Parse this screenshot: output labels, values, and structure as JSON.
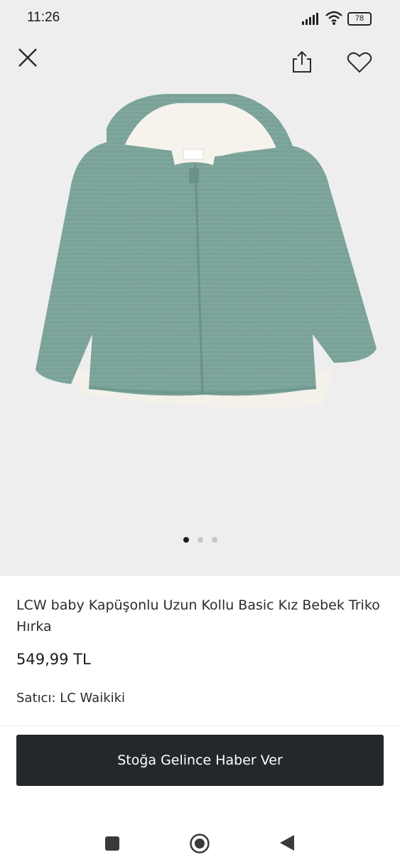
{
  "status_bar": {
    "time": "11:26",
    "battery": "78",
    "icons": [
      "signal-icon",
      "wifi-icon",
      "battery-icon"
    ]
  },
  "top_bar": {
    "icons": [
      "close-icon",
      "share-icon",
      "heart-icon"
    ]
  },
  "gallery": {
    "image_subject": "mint-green knitted hooded baby cardigan with zipper",
    "page_count": 3,
    "active_index": 0
  },
  "product": {
    "title": "LCW baby Kapüşonlu Uzun Kollu Basic Kız Bebek Triko Hırka",
    "price": "549,99 TL",
    "seller": "Satıcı: LC Waikiki"
  },
  "cta": {
    "label": "Stoğa Gelince Haber Ver",
    "background": "#24272b"
  },
  "nav_bar": {
    "icons": [
      "recents-square-icon",
      "home-circle-icon",
      "back-triangle-icon"
    ]
  }
}
